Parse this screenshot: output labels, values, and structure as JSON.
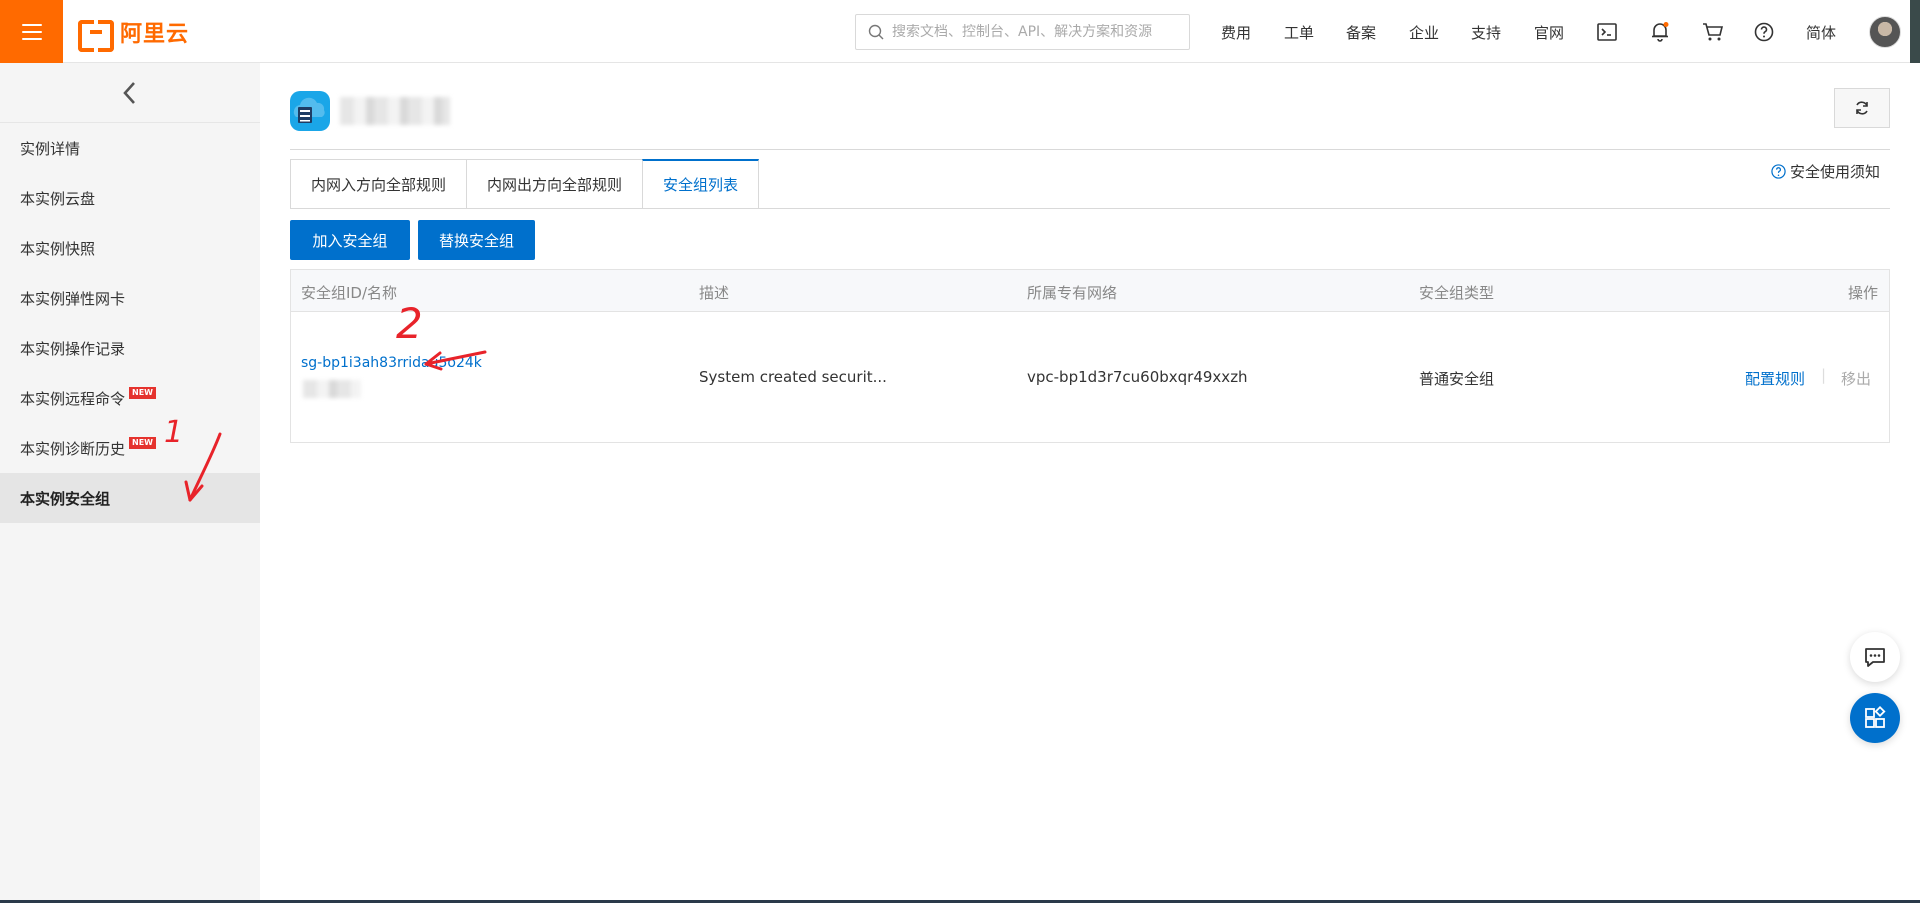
{
  "topbar": {
    "logo_text": "阿里云",
    "search_placeholder": "搜索文档、控制台、API、解决方案和资源",
    "nav": [
      "费用",
      "工单",
      "备案",
      "企业",
      "支持",
      "官网"
    ],
    "language": "简体",
    "icons": [
      "terminal-icon",
      "bell-icon",
      "cart-icon",
      "help-icon"
    ]
  },
  "sidebar": {
    "items": [
      {
        "label": "实例详情",
        "badge": ""
      },
      {
        "label": "本实例云盘",
        "badge": ""
      },
      {
        "label": "本实例快照",
        "badge": ""
      },
      {
        "label": "本实例弹性网卡",
        "badge": ""
      },
      {
        "label": "本实例操作记录",
        "badge": ""
      },
      {
        "label": "本实例远程命令",
        "badge": "NEW"
      },
      {
        "label": "本实例诊断历史",
        "badge": "NEW"
      },
      {
        "label": "本实例安全组",
        "badge": ""
      }
    ]
  },
  "main": {
    "tabs": [
      "内网入方向全部规则",
      "内网出方向全部规则",
      "安全组列表"
    ],
    "help_link": "安全使用须知",
    "buttons": {
      "join": "加入安全组",
      "replace": "替换安全组"
    },
    "table": {
      "headers": [
        "安全组ID/名称",
        "描述",
        "所属专有网络",
        "安全组类型",
        "操作"
      ],
      "row": {
        "id": "sg-bp1i3ah83rridau5o24k",
        "description": "System created securit...",
        "vpc": "vpc-bp1d3r7cu60bxqr49xxzh",
        "type": "普通安全组",
        "action_config": "配置规则",
        "action_remove": "移出"
      }
    }
  },
  "annotations": {
    "one": "1",
    "two": "2"
  },
  "colors": {
    "brand": "#ff6a00",
    "primary": "#0070cc",
    "annotation": "#e8232a"
  }
}
